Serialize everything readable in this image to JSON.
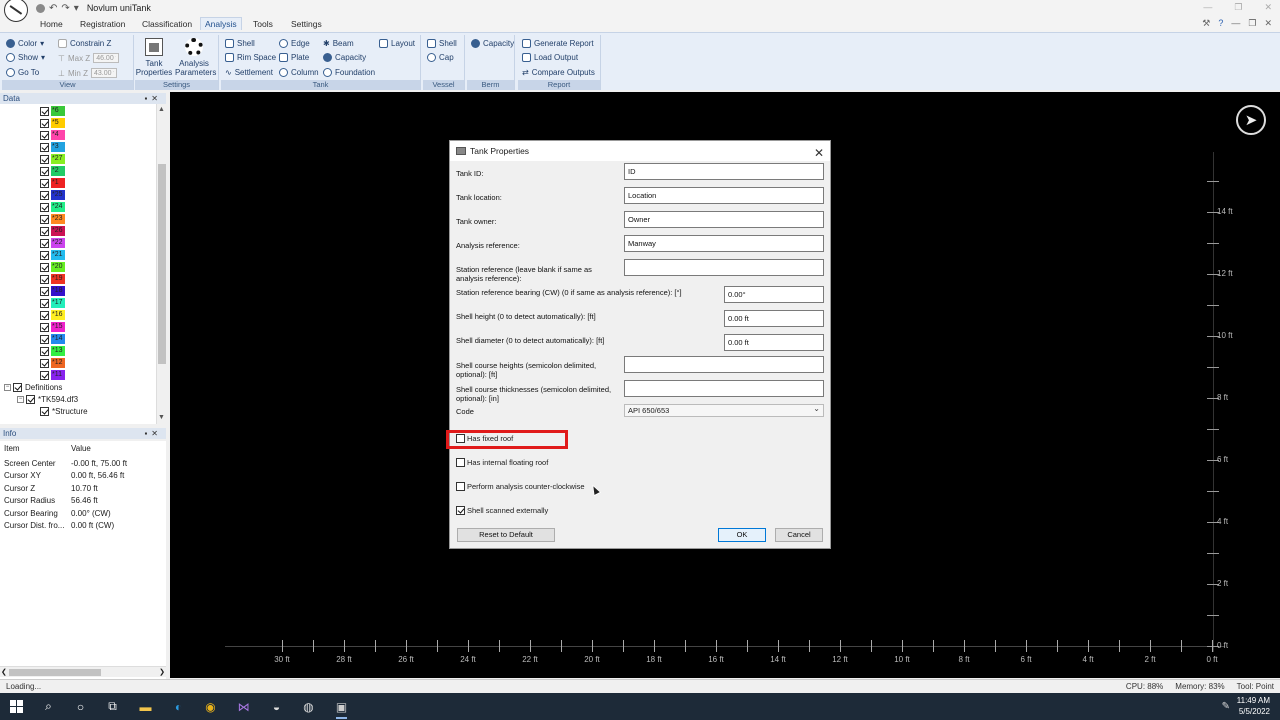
{
  "window": {
    "title": "Novlum uniTank"
  },
  "menu": {
    "tabs": [
      "Home",
      "Registration",
      "Classification",
      "Analysis",
      "Tools",
      "Settings"
    ],
    "active": "Analysis"
  },
  "ribbon": {
    "view": {
      "label": "View",
      "color": "Color",
      "show": "Show",
      "goto": "Go To",
      "constrain_z": "Constrain Z",
      "max_z": "Max Z",
      "max_z_value": "46.00 ft",
      "min_z": "Min Z",
      "min_z_value": "43.00 ft"
    },
    "settings": {
      "label": "Settings",
      "tank_properties": "Tank Properties",
      "analysis_parameters": "Analysis Parameters"
    },
    "tank": {
      "label": "Tank",
      "shell": "Shell",
      "rim_space": "Rim Space",
      "settlement": "Settlement",
      "edge": "Edge",
      "plate": "Plate",
      "column": "Column",
      "beam": "Beam",
      "capacity": "Capacity",
      "foundation": "Foundation",
      "layout": "Layout"
    },
    "vessel": {
      "label": "Vessel",
      "shell": "Shell",
      "cap": "Cap"
    },
    "berm": {
      "label": "Berm",
      "capacity": "Capacity"
    },
    "report": {
      "label": "Report",
      "generate": "Generate Report",
      "load": "Load Output",
      "compare": "Compare Outputs"
    }
  },
  "data_panel": {
    "title": "Data",
    "items": [
      {
        "label": "*6",
        "color": "#39c839"
      },
      {
        "label": "*5",
        "color": "#ffcc00"
      },
      {
        "label": "*4",
        "color": "#ff44aa"
      },
      {
        "label": "*3",
        "color": "#22a3e0"
      },
      {
        "label": "*27",
        "color": "#88ee22"
      },
      {
        "label": "*2",
        "color": "#22cc66"
      },
      {
        "label": "*1",
        "color": "#ee2222"
      },
      {
        "label": "*25",
        "color": "#2233cc"
      },
      {
        "label": "*24",
        "color": "#22ee88"
      },
      {
        "label": "*23",
        "color": "#ff8822"
      },
      {
        "label": "*26",
        "color": "#cc1155"
      },
      {
        "label": "*22",
        "color": "#cc44ee"
      },
      {
        "label": "*21",
        "color": "#22bbee"
      },
      {
        "label": "*20",
        "color": "#66ee22"
      },
      {
        "label": "*19",
        "color": "#ee3322"
      },
      {
        "label": "*18",
        "color": "#3311cc"
      },
      {
        "label": "*17",
        "color": "#22eebb"
      },
      {
        "label": "*16",
        "color": "#ffee22"
      },
      {
        "label": "*15",
        "color": "#ee22cc"
      },
      {
        "label": "*14",
        "color": "#2288ee"
      },
      {
        "label": "*13",
        "color": "#33ee44"
      },
      {
        "label": "*12",
        "color": "#ee6622"
      },
      {
        "label": "*11",
        "color": "#8822ee"
      }
    ],
    "definitions": "Definitions",
    "file": "*TK594.df3",
    "structure": "*Structure"
  },
  "info_panel": {
    "title": "Info",
    "col_item": "Item",
    "col_value": "Value",
    "rows": [
      {
        "item": "Screen Center",
        "value": "-0.00 ft, 75.00 ft"
      },
      {
        "item": "Cursor XY",
        "value": "0.00 ft, 56.46 ft"
      },
      {
        "item": "Cursor Z",
        "value": "10.70 ft"
      },
      {
        "item": "Cursor Radius",
        "value": "56.46 ft"
      },
      {
        "item": "Cursor Bearing",
        "value": "0.00° (CW)"
      },
      {
        "item": "Cursor Dist. fro...",
        "value": "0.00 ft (CW)"
      }
    ]
  },
  "viewport": {
    "y_labels": [
      "14 ft",
      "12 ft",
      "10 ft",
      "8 ft",
      "6 ft",
      "4 ft",
      "2 ft",
      "0 ft"
    ],
    "x_labels": [
      "30 ft",
      "28 ft",
      "26 ft",
      "24 ft",
      "22 ft",
      "20 ft",
      "18 ft",
      "16 ft",
      "14 ft",
      "12 ft",
      "10 ft",
      "8 ft",
      "6 ft",
      "4 ft",
      "2 ft",
      "0 ft"
    ]
  },
  "dialog": {
    "title": "Tank Properties",
    "tank_id": {
      "label": "Tank ID:",
      "value": "ID"
    },
    "tank_location": {
      "label": "Tank location:",
      "value": "Location"
    },
    "tank_owner": {
      "label": "Tank owner:",
      "value": "Owner"
    },
    "analysis_reference": {
      "label": "Analysis reference:",
      "value": "Manway"
    },
    "station_reference": {
      "label": "Station reference (leave blank if same as analysis reference):",
      "value": ""
    },
    "station_bearing": {
      "label": "Station reference bearing (CW) (0 if same as analysis reference): [°]",
      "value": "0.00°"
    },
    "shell_height": {
      "label": "Shell height (0 to detect automatically): [ft]",
      "value": "0.00 ft"
    },
    "shell_diameter": {
      "label": "Shell diameter (0 to detect automatically): [ft]",
      "value": "0.00 ft"
    },
    "course_heights": {
      "label": "Shell course heights (semicolon delimited, optional): [ft]",
      "value": ""
    },
    "course_thicknesses": {
      "label": "Shell course thicknesses (semicolon delimited, optional): [in]",
      "value": ""
    },
    "code": {
      "label": "Code",
      "value": "API 650/653"
    },
    "has_fixed_roof": "Has fixed roof",
    "has_internal_floating_roof": "Has internal floating roof",
    "counter_clockwise": "Perform analysis counter-clockwise",
    "scanned_externally": "Shell scanned externally",
    "reset": "Reset to Default",
    "ok": "OK",
    "cancel": "Cancel"
  },
  "status": {
    "left": "Loading...",
    "cpu": "CPU: 88%",
    "memory": "Memory: 83%",
    "tool": "Tool: Point"
  },
  "taskbar": {
    "time": "11:49 AM",
    "date": "5/5/2022"
  }
}
